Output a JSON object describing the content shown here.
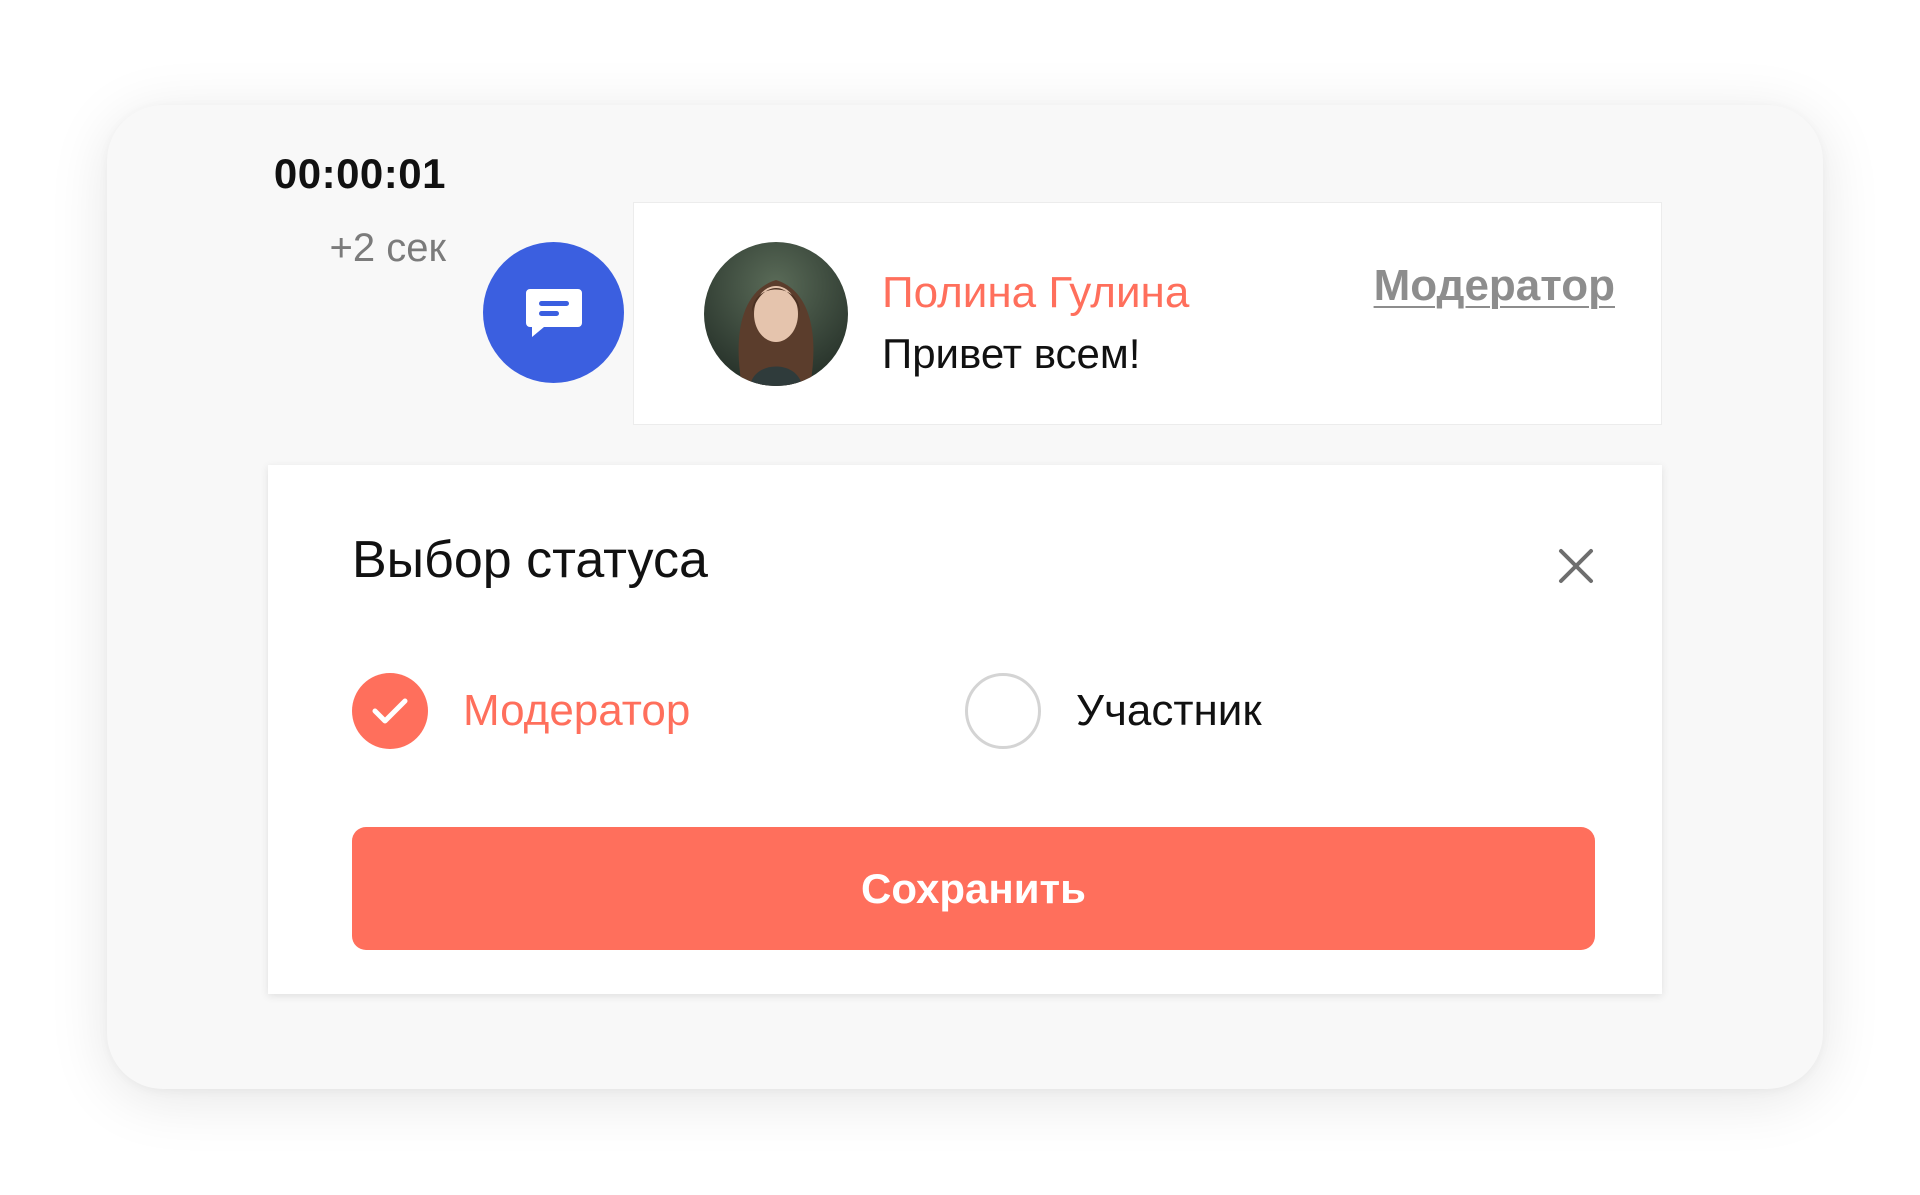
{
  "timer": {
    "elapsed": "00:00:01",
    "delta": "+2 сек"
  },
  "message": {
    "icon": "chat-message-icon",
    "author": "Полина Гулина",
    "text": "Привет всем!",
    "role_link": "Модератор"
  },
  "modal": {
    "title": "Выбор статуса",
    "close_icon": "close-icon",
    "options": [
      {
        "label": "Модератор",
        "selected": true
      },
      {
        "label": "Участник",
        "selected": false
      }
    ],
    "save_label": "Сохранить"
  },
  "colors": {
    "accent": "#ff6f5c",
    "chat_icon_bg": "#3b5fe0",
    "muted_text": "#8d8d8d"
  }
}
